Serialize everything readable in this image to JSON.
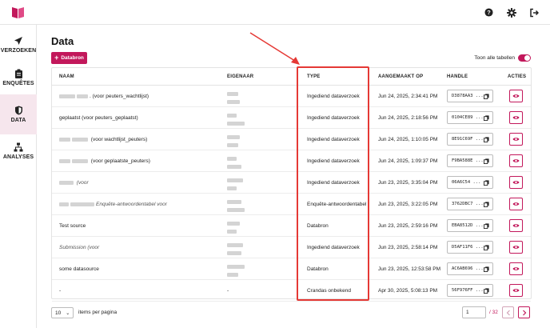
{
  "nav": {
    "items": [
      {
        "label": "VERZOEKEN",
        "icon": "send-icon",
        "active": false
      },
      {
        "label": "ENQUÊTES",
        "icon": "clipboard-icon",
        "active": false
      },
      {
        "label": "DATA",
        "icon": "shield-icon",
        "active": true
      },
      {
        "label": "ANALYSES",
        "icon": "network-icon",
        "active": false
      }
    ]
  },
  "topbar": {
    "help_icon": "help-icon",
    "settings_icon": "gear-icon",
    "logout_icon": "logout-icon"
  },
  "page": {
    "title": "Data",
    "add_button": "Databron",
    "toggle_label": "Toon alle tabellen",
    "toggle_on": true
  },
  "table": {
    "headers": {
      "naam": "NAAM",
      "eigenaar": "EIGENAAR",
      "type": "TYPE",
      "aangemaakt": "AANGEMAAKT OP",
      "handle": "HANDLE",
      "acties": "ACTIES"
    },
    "rows": [
      {
        "naam_pre": ". (voor ",
        "naam_name": "peuters_wachtlijst",
        "naam_post": ")",
        "type": "Ingediend dataverzoek",
        "date": "Jun 24, 2025, 2:34:41 PM",
        "handle": "D3878AA3 ..."
      },
      {
        "naam_pre": "geplaatst (voor ",
        "naam_name": "peuters_geplaatst",
        "naam_post": ")",
        "type": "Ingediend dataverzoek",
        "date": "Jun 24, 2025, 2:18:56 PM",
        "handle": "0104CE89 ..."
      },
      {
        "naam_pre": " (voor ",
        "naam_name": "wachtlijst_peuters",
        "naam_post": ")",
        "type": "Ingediend dataverzoek",
        "date": "Jun 24, 2025, 1:10:05 PM",
        "handle": "8E91C69F ..."
      },
      {
        "naam_pre": " (voor ",
        "naam_name": "geplaatste_peuters",
        "naam_post": ")",
        "type": "Ingediend dataverzoek",
        "date": "Jun 24, 2025, 1:09:37 PM",
        "handle": "F9BA588E ..."
      },
      {
        "naam_pre": " (voor ",
        "naam_name": "",
        "naam_post": "",
        "type": "Ingediend dataverzoek",
        "date": "Jun 23, 2025, 3:35:04 PM",
        "handle": "06A6C54 ..."
      },
      {
        "naam_pre": "Enquête-antwoordentabel voor ",
        "naam_name": "",
        "naam_post": "",
        "type": "Enquête-antwoordentabel",
        "date": "Jun 23, 2025, 3:22:05 PM",
        "handle": "3762DBC7 ..."
      },
      {
        "naam_pre": "Test source",
        "naam_name": "",
        "naam_post": "",
        "type": "Databron",
        "date": "Jun 23, 2025, 2:59:16 PM",
        "handle": "EBA8512D ..."
      },
      {
        "naam_pre": "Submission (voor ",
        "naam_name": "",
        "naam_post": "",
        "type": "Ingediend dataverzoek",
        "date": "Jun 23, 2025, 2:58:14 PM",
        "handle": "D5AF11F6 ..."
      },
      {
        "naam_pre": "some datasource",
        "naam_name": "",
        "naam_post": "",
        "type": "Databron",
        "date": "Jun 23, 2025, 12:53:58 PM",
        "handle": "AC6AB696 ..."
      },
      {
        "naam_pre": "-",
        "naam_name": "",
        "naam_post": "",
        "eigenaar": "-",
        "type": "Crandas onbekend",
        "date": "Apr 30, 2025, 5:08:13 PM",
        "handle": "56F976FF ..."
      }
    ]
  },
  "pagination": {
    "page_size": "10",
    "page_size_label": "items per pagina",
    "current_page": "1",
    "total_pages": "/ 32"
  }
}
